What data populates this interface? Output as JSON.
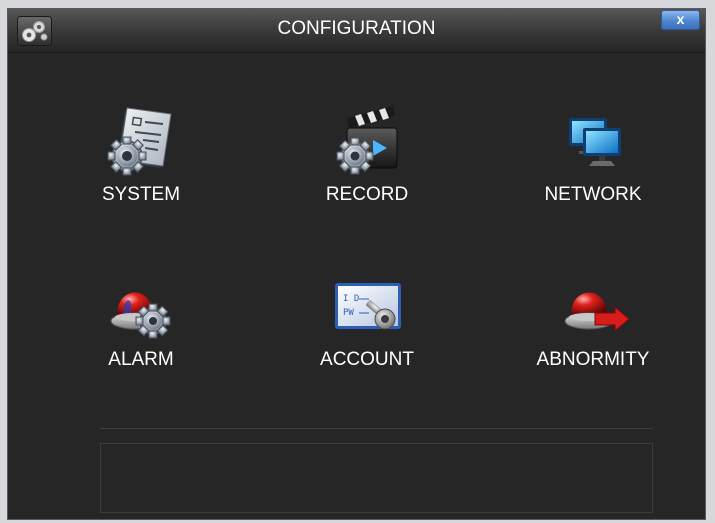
{
  "window": {
    "title": "CONFIGURATION",
    "close_label": "x",
    "title_icon": "gears-icon"
  },
  "menu": {
    "items": [
      {
        "label": "SYSTEM",
        "icon": "system-settings-icon"
      },
      {
        "label": "RECORD",
        "icon": "record-clapperboard-icon"
      },
      {
        "label": "NETWORK",
        "icon": "network-monitors-icon"
      },
      {
        "label": "ALARM",
        "icon": "alarm-siren-gear-icon"
      },
      {
        "label": "ACCOUNT",
        "icon": "account-key-card-icon"
      },
      {
        "label": "ABNORMITY",
        "icon": "abnormity-siren-arrow-icon"
      }
    ]
  },
  "status": {
    "text": ""
  },
  "colors": {
    "background": "#262626",
    "titlebar": "#3a3a3a",
    "text": "#ffffff",
    "close_button": "#4f86d0"
  }
}
